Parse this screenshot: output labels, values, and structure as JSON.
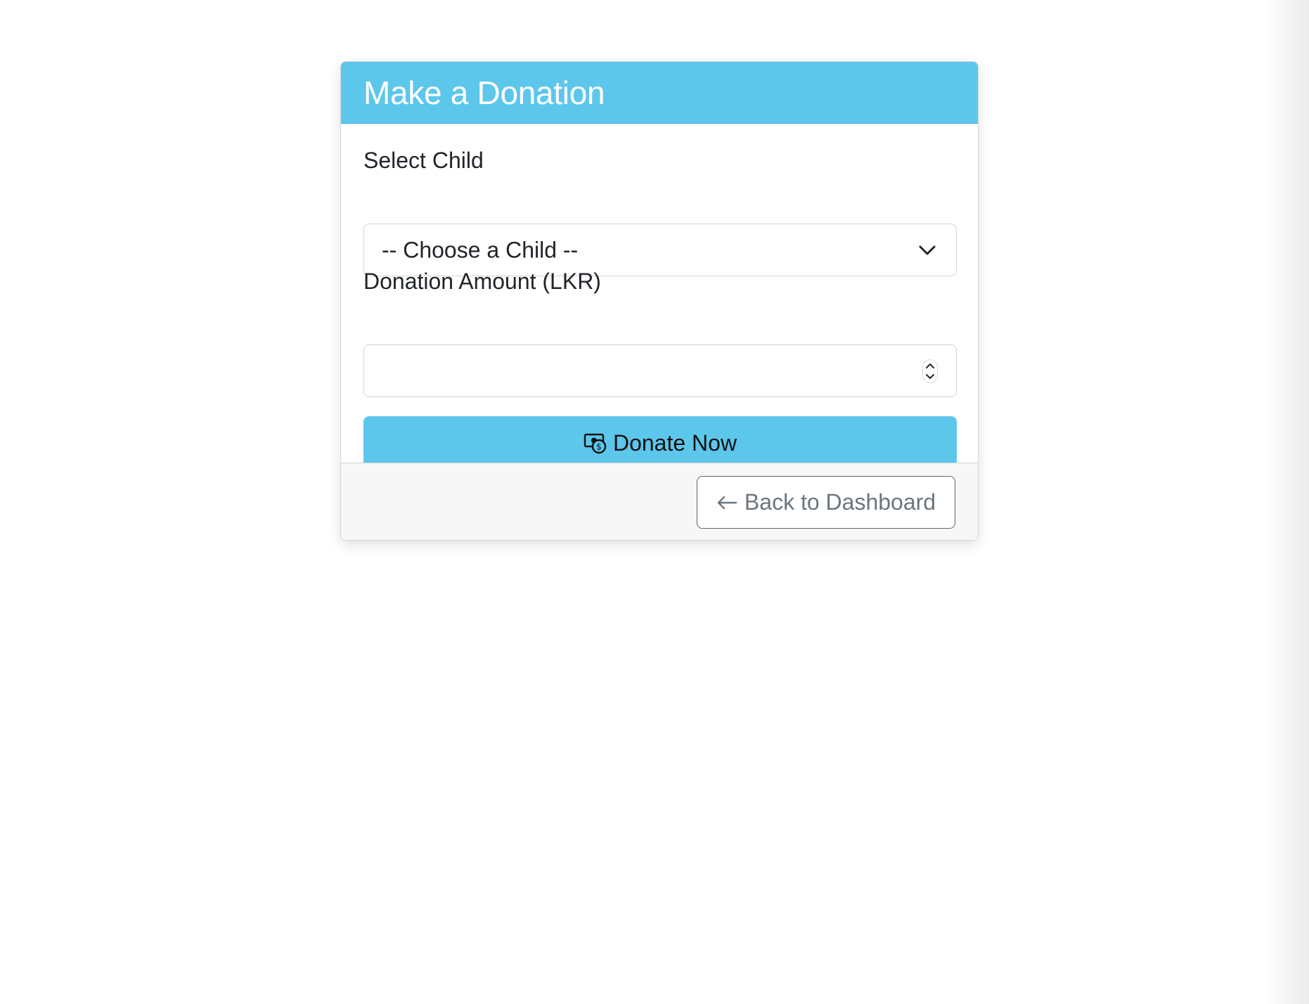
{
  "card": {
    "title": "Make a Donation"
  },
  "form": {
    "child_label": "Select Child",
    "child_select_value": "-- Choose a Child --",
    "amount_label": "Donation Amount (LKR)",
    "amount_value": "",
    "submit_label": "Donate Now",
    "submit_icon": "cash-coin-icon"
  },
  "footer": {
    "back_label": "Back to Dashboard",
    "back_icon": "arrow-left-icon"
  },
  "colors": {
    "primary": "#5dc7eb",
    "text": "#212529",
    "muted": "#6c757d",
    "footer_bg": "#f7f7f7"
  }
}
